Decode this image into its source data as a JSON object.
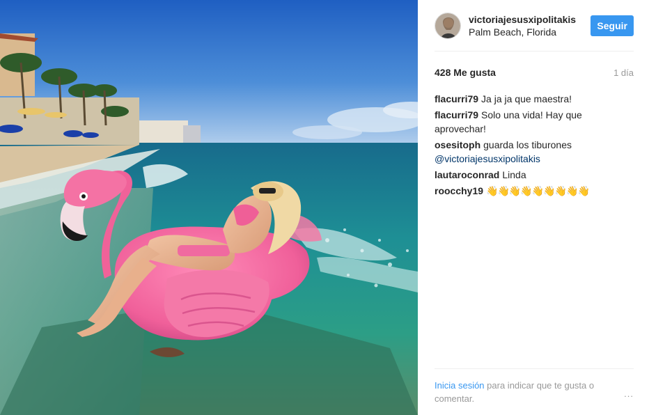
{
  "post": {
    "username": "victoriajesusxipolitakis",
    "location": "Palm Beach, Florida",
    "follow_label": "Seguir",
    "likes": "428 Me gusta",
    "time_ago": "1 día"
  },
  "comments": [
    {
      "author": "flacurri79",
      "text": "Ja ja ja que maestra!"
    },
    {
      "author": "flacurri79",
      "text": "Solo una vida! Hay que aprovechar!"
    },
    {
      "author": "osesitoph",
      "text": "guarda los tiburones",
      "mention": "@victoriajesusxipolitakis"
    },
    {
      "author": "lautaroconrad",
      "text": "Linda"
    },
    {
      "author": "roocchy19",
      "text": "👋👋👋👋👋👋👋👋👋"
    }
  ],
  "footer": {
    "login_link": "Inicia sesión",
    "login_rest": "para indicar que te gusta o comentar.",
    "more_icon": "..."
  },
  "colors": {
    "accent": "#3897f0",
    "flamingo": "#f26a9a",
    "sea": "#1f8fa0",
    "sky": "#3a7fd0"
  },
  "icons": {
    "more": "more-options-icon",
    "photo": "post-photo"
  }
}
